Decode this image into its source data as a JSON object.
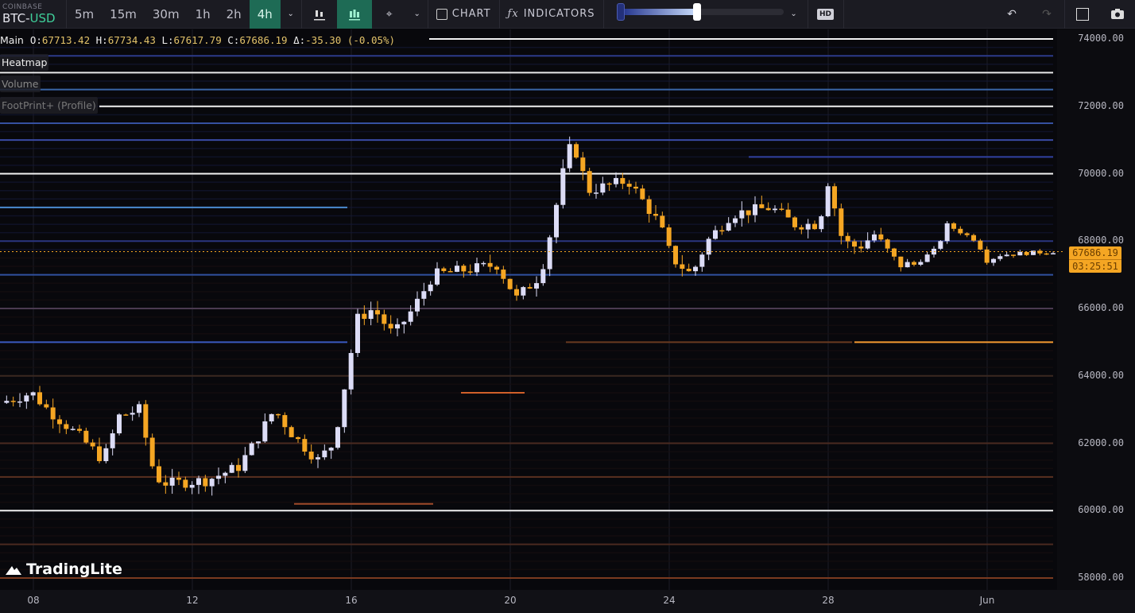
{
  "toolbar": {
    "exchange": "COINBASE",
    "base": "BTC",
    "dash": "-",
    "quote": "USD",
    "timeframes": [
      "5m",
      "15m",
      "30m",
      "1h",
      "2h",
      "4h"
    ],
    "active_timeframe": "4h",
    "chart_label": "CHART",
    "indicators_label": "INDICATORS",
    "hd_label": "HD"
  },
  "legend": {
    "name": "Main",
    "o_k": "O:",
    "o": "67713.42",
    "h_k": "H:",
    "h": "67734.43",
    "l_k": "L:",
    "l": "67617.79",
    "c_k": "C:",
    "c": "67686.19",
    "d_k": "Δ:",
    "d": "-35.30 (-0.05%)"
  },
  "layers": [
    "Heatmap",
    "Volume",
    "FootPrint+ (Profile)"
  ],
  "price_tag": {
    "price": "67686.19",
    "countdown": "03:25:51"
  },
  "logo": "TradingLite",
  "colors": {
    "up": "#dcdcf6",
    "down": "#f5a623",
    "bg": "#08080c"
  },
  "chart_data": {
    "type": "candlestick",
    "symbol": "BTC-USD",
    "interval": "4h",
    "y_ticks": [
      "74000.00",
      "72000.00",
      "70000.00",
      "68000.00",
      "66000.00",
      "64000.00",
      "62000.00",
      "60000.00",
      "58000.00"
    ],
    "ylim": [
      58000,
      74000
    ],
    "x_ticks": [
      "08",
      "12",
      "16",
      "20",
      "24",
      "28",
      "Jun"
    ],
    "x_tick_days": [
      0,
      4,
      8,
      12,
      16,
      20,
      24
    ],
    "xlim_days": [
      -0.84,
      25.9
    ],
    "price_path": [
      [
        -0.84,
        63200
      ],
      [
        -0.04,
        63500
      ],
      [
        0.36,
        63000
      ],
      [
        1.16,
        62200
      ],
      [
        1.76,
        61500
      ],
      [
        2.16,
        62800
      ],
      [
        2.66,
        63000
      ],
      [
        3.06,
        61000
      ],
      [
        3.36,
        60800
      ],
      [
        4.36,
        60900
      ],
      [
        5.16,
        61300
      ],
      [
        5.56,
        62000
      ],
      [
        6.06,
        63000
      ],
      [
        6.56,
        62200
      ],
      [
        7.16,
        61500
      ],
      [
        7.56,
        62000
      ],
      [
        7.96,
        64500
      ],
      [
        8.16,
        65700
      ],
      [
        8.56,
        66000
      ],
      [
        9.06,
        65200
      ],
      [
        9.56,
        66000
      ],
      [
        10.06,
        67000
      ],
      [
        11.16,
        67200
      ],
      [
        11.66,
        67300
      ],
      [
        12.16,
        66300
      ],
      [
        12.76,
        67000
      ],
      [
        13.06,
        68500
      ],
      [
        13.32,
        70000
      ],
      [
        13.56,
        71000
      ],
      [
        13.96,
        69500
      ],
      [
        14.96,
        69800
      ],
      [
        15.76,
        68500
      ],
      [
        16.06,
        67500
      ],
      [
        16.56,
        67000
      ],
      [
        16.96,
        68000
      ],
      [
        17.56,
        68800
      ],
      [
        18.56,
        69000
      ],
      [
        19.16,
        68500
      ],
      [
        19.76,
        68500
      ],
      [
        20.0,
        69800
      ],
      [
        20.36,
        68000
      ],
      [
        20.76,
        67800
      ],
      [
        21.16,
        68200
      ],
      [
        21.76,
        67300
      ],
      [
        22.16,
        67300
      ],
      [
        22.76,
        67800
      ],
      [
        22.96,
        68500
      ],
      [
        23.76,
        68000
      ],
      [
        23.96,
        67400
      ],
      [
        24.36,
        67600
      ],
      [
        25.66,
        67690
      ]
    ],
    "current_price": 67686.19,
    "heatmap_levels": [
      {
        "price": 74000,
        "from": 9.96,
        "to": 25.66,
        "color": "#f2f2f2"
      },
      {
        "price": 73500,
        "from": -0.84,
        "to": 25.66,
        "color": "#2c3a8a"
      },
      {
        "price": 73000,
        "from": -0.84,
        "to": 25.66,
        "color": "#e8e8e8"
      },
      {
        "price": 72500,
        "from": -0.84,
        "to": 25.66,
        "color": "#3a66a8"
      },
      {
        "price": 72000,
        "from": 1.66,
        "to": 25.66,
        "color": "#f0f0f0"
      },
      {
        "price": 71500,
        "from": -0.84,
        "to": 25.66,
        "color": "#3550a0"
      },
      {
        "price": 71000,
        "from": -0.84,
        "to": 25.66,
        "color": "#3a4aa5"
      },
      {
        "price": 70500,
        "from": 18.0,
        "to": 25.66,
        "color": "#3040a0"
      },
      {
        "price": 70000,
        "from": -0.84,
        "to": 25.66,
        "color": "#f4f4f4"
      },
      {
        "price": 69000,
        "from": -0.84,
        "to": 7.9,
        "color": "#4a8ad0"
      },
      {
        "price": 68000,
        "from": -0.84,
        "to": 25.66,
        "color": "#2a3580"
      },
      {
        "price": 67000,
        "from": -0.84,
        "to": 25.66,
        "color": "#3050a0"
      },
      {
        "price": 66000,
        "from": -0.84,
        "to": 25.66,
        "color": "#4a3a50"
      },
      {
        "price": 65000,
        "from": -0.84,
        "to": 7.9,
        "color": "#3a5ac0"
      },
      {
        "price": 65000,
        "from": 20.66,
        "to": 25.66,
        "color": "#f59a30"
      },
      {
        "price": 65000,
        "from": 13.4,
        "to": 20.6,
        "color": "#6a3a20"
      },
      {
        "price": 64000,
        "from": -0.84,
        "to": 25.66,
        "color": "#3a2820"
      },
      {
        "price": 63500,
        "from": 10.76,
        "to": 12.36,
        "color": "#d0602a"
      },
      {
        "price": 62000,
        "from": -0.84,
        "to": 25.66,
        "color": "#4a2a20"
      },
      {
        "price": 61000,
        "from": -0.84,
        "to": 25.66,
        "color": "#5a3020"
      },
      {
        "price": 60200,
        "from": 6.56,
        "to": 10.06,
        "color": "#a04a2a"
      },
      {
        "price": 60000,
        "from": -0.84,
        "to": 25.66,
        "color": "#f0f0f0"
      },
      {
        "price": 59000,
        "from": -0.84,
        "to": 25.66,
        "color": "#4a2a20"
      },
      {
        "price": 58000,
        "from": -0.84,
        "to": 25.66,
        "color": "#7a3a20"
      }
    ]
  }
}
